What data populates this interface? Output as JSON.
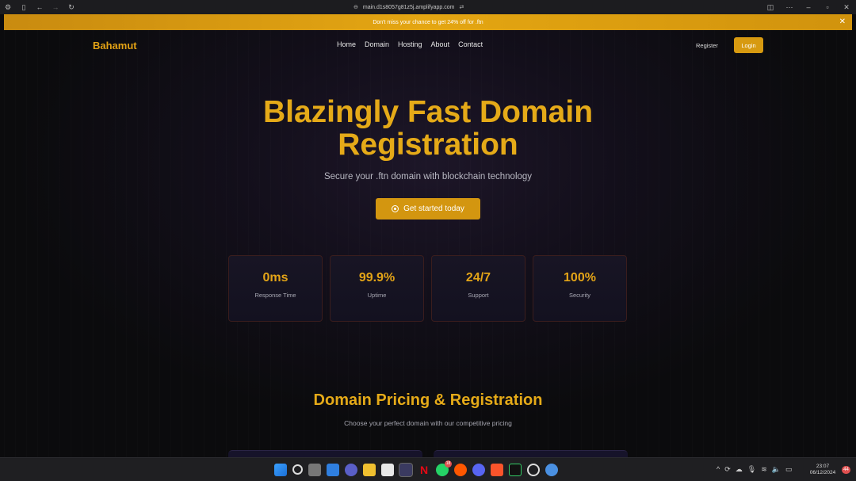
{
  "browser": {
    "url": "main.d1s8057g81z5j.amplifyapp.com"
  },
  "banner": {
    "text": "Don't miss your chance to get 24% off for .ftn",
    "close": "✕"
  },
  "nav": {
    "brand": "Bahamut",
    "links": [
      "Home",
      "Domain",
      "Hosting",
      "About",
      "Contact"
    ],
    "register": "Register",
    "login": "Login"
  },
  "hero": {
    "title_line1": "Blazingly Fast Domain",
    "title_line2": "Registration",
    "subtitle": "Secure your .ftn domain with blockchain technology",
    "cta": "Get started today"
  },
  "stats": [
    {
      "value": "0ms",
      "label": "Response Time"
    },
    {
      "value": "99.9%",
      "label": "Uptime"
    },
    {
      "value": "24/7",
      "label": "Support"
    },
    {
      "value": "100%",
      "label": "Security"
    }
  ],
  "pricing": {
    "title": "Domain Pricing & Registration",
    "subtitle": "Choose your perfect domain with our competitive pricing"
  },
  "taskbar": {
    "time": "23:07",
    "date": "06/12/2024",
    "whatsapp_badge": "18",
    "notifications": "44",
    "icons": [
      "windows-start",
      "search",
      "task-view",
      "widgets",
      "teams",
      "file-explorer",
      "calendar",
      "bookmark-app",
      "netflix",
      "whatsapp",
      "reddit",
      "discord",
      "brave",
      "terminal",
      "chatgpt",
      "chrome"
    ],
    "colors": {
      "accent": "#e5aa18",
      "button": "#d39610",
      "taskbar": "#1f1f22"
    }
  }
}
